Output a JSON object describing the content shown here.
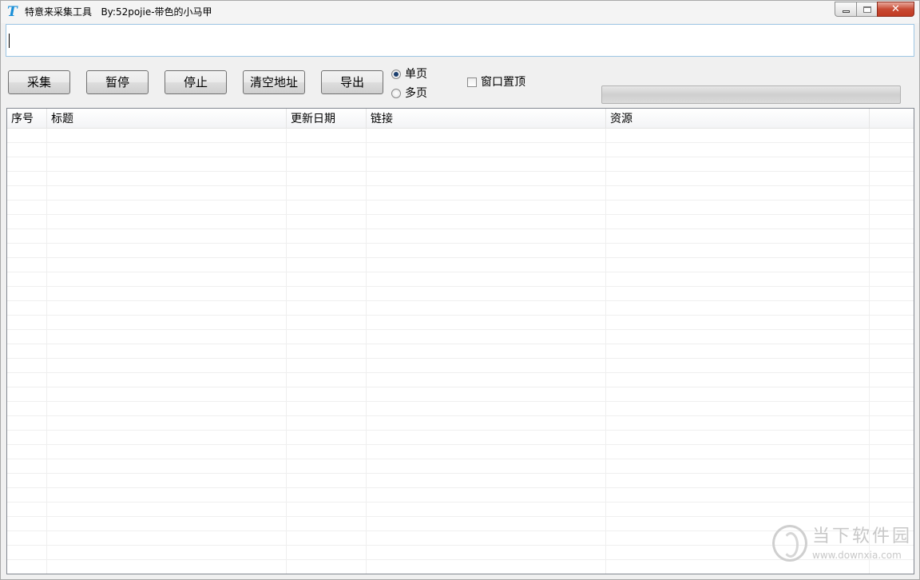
{
  "window": {
    "title": "特意来采集工具   By:52pojie-带色的小马甲",
    "icon": "T",
    "controls": {
      "minimize": "minimize-icon",
      "maximize": "maximize-icon",
      "close": "✕"
    }
  },
  "url_input": {
    "value": "",
    "placeholder": ""
  },
  "toolbar": {
    "collect_label": "采集",
    "pause_label": "暂停",
    "stop_label": "停止",
    "clear_label": "清空地址",
    "export_label": "导出"
  },
  "page_mode": {
    "options": [
      {
        "label": "单页",
        "checked": true
      },
      {
        "label": "多页",
        "checked": false
      }
    ]
  },
  "always_on_top": {
    "label": "窗口置顶",
    "checked": false
  },
  "progress": {
    "value": 0
  },
  "table": {
    "columns": [
      "序号",
      "标题",
      "更新日期",
      "链接",
      "资源"
    ],
    "rows": []
  },
  "watermark": {
    "title": "当下软件园",
    "url": "www.downxia.com"
  },
  "colors": {
    "accent": "#1a8fd8",
    "close_button": "#c74a33",
    "input_border": "#9ec6e4"
  }
}
